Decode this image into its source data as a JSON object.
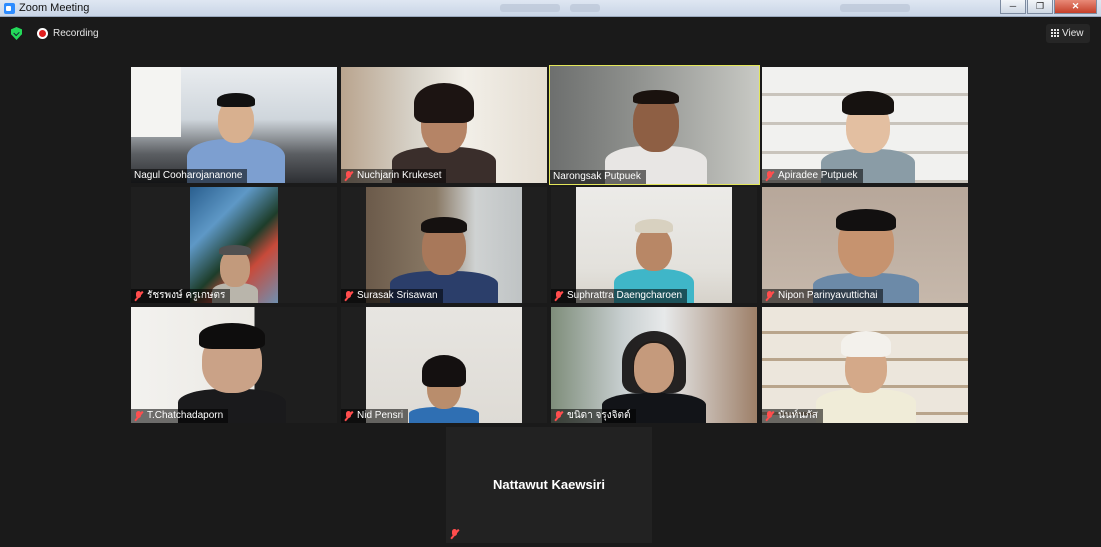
{
  "window": {
    "title": "Zoom Meeting",
    "controls": [
      "─",
      "❐",
      "✕"
    ]
  },
  "toolbar": {
    "recording_label": "Recording",
    "view_label": "View"
  },
  "participants": [
    {
      "name": "Nagul Cooharojananone",
      "muted": false,
      "active": false
    },
    {
      "name": "Nuchjarin Krukeset",
      "muted": true,
      "active": false
    },
    {
      "name": "Narongsak Putpuek",
      "muted": false,
      "active": true
    },
    {
      "name": "Apiradee  Putpuek",
      "muted": true,
      "active": false
    },
    {
      "name": "รัชรพงษ์  ครูเกษตร",
      "muted": true,
      "active": false
    },
    {
      "name": "Surasak Srisawan",
      "muted": true,
      "active": false
    },
    {
      "name": "Suphrattra Daengcharoen",
      "muted": true,
      "active": false
    },
    {
      "name": "Nipon Parinyavuttichai",
      "muted": true,
      "active": false
    },
    {
      "name": "T.Chatchadaporn",
      "muted": true,
      "active": false
    },
    {
      "name": "Nid Pensri",
      "muted": true,
      "active": false
    },
    {
      "name": "ขนิดา จรุงจิตต์",
      "muted": true,
      "active": false
    },
    {
      "name": "นันท์นภัส",
      "muted": true,
      "active": false
    },
    {
      "name": "Nattawut Kaewsiri",
      "muted": true,
      "active": false,
      "video_off": true
    }
  ]
}
